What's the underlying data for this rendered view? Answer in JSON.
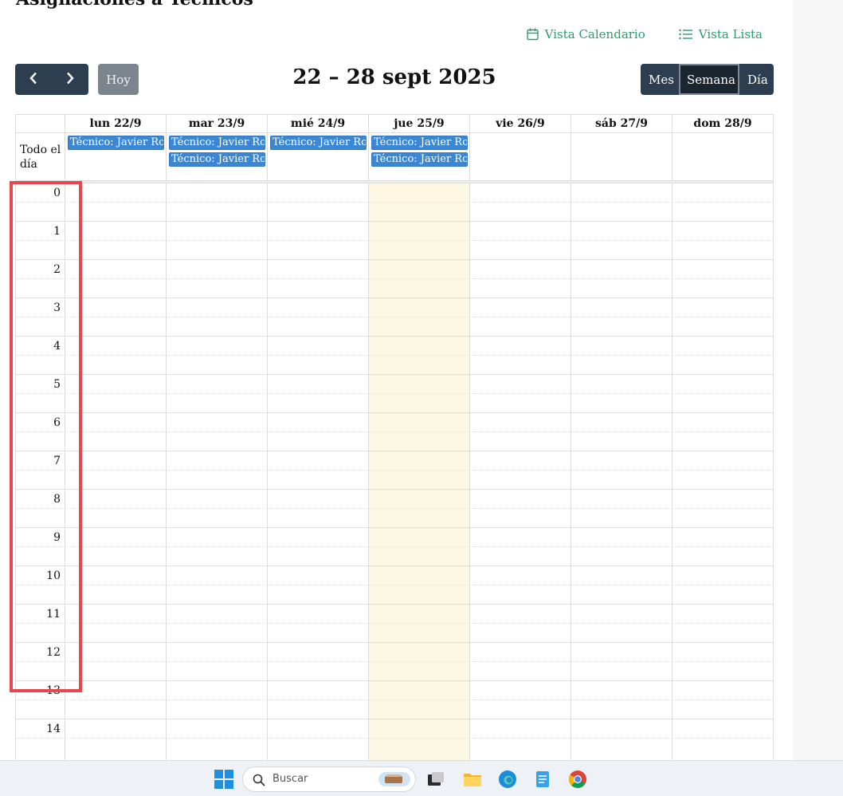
{
  "page": {
    "heading": "Asignaciones a Técnicos"
  },
  "view_links": {
    "calendar_label": "Vista Calendario",
    "list_label": "Vista Lista"
  },
  "toolbar": {
    "today_label": "Hoy",
    "title": "22 – 28 sept 2025",
    "views": [
      "Mes",
      "Semana",
      "Día"
    ],
    "active_view": "Semana"
  },
  "calendar": {
    "allday_label": "Todo el día",
    "days": [
      {
        "label": "lun 22/9",
        "events": [
          "Técnico: Javier Romo"
        ]
      },
      {
        "label": "mar 23/9",
        "events": [
          "Técnico: Javier Romo",
          "Técnico: Javier Romo"
        ]
      },
      {
        "label": "mié 24/9",
        "events": [
          "Técnico: Javier Romo"
        ]
      },
      {
        "label": "jue 25/9",
        "events": [
          "Técnico: Javier Romo",
          "Técnico: Javier Romo"
        ],
        "today": true
      },
      {
        "label": "vie 26/9",
        "events": []
      },
      {
        "label": "sáb 27/9",
        "events": []
      },
      {
        "label": "dom 28/9",
        "events": []
      }
    ],
    "hours": [
      "0",
      "1",
      "2",
      "3",
      "4",
      "5",
      "6",
      "7",
      "8",
      "9",
      "10",
      "11",
      "12",
      "13",
      "14"
    ]
  },
  "taskbar": {
    "search_placeholder": "Buscar"
  },
  "colors": {
    "accent_green": "#2a9d6d",
    "button_dark": "#2c3e50",
    "event_blue": "#3a87d5",
    "today_bg": "#fcf8e3",
    "highlight_red": "#e8474c"
  }
}
